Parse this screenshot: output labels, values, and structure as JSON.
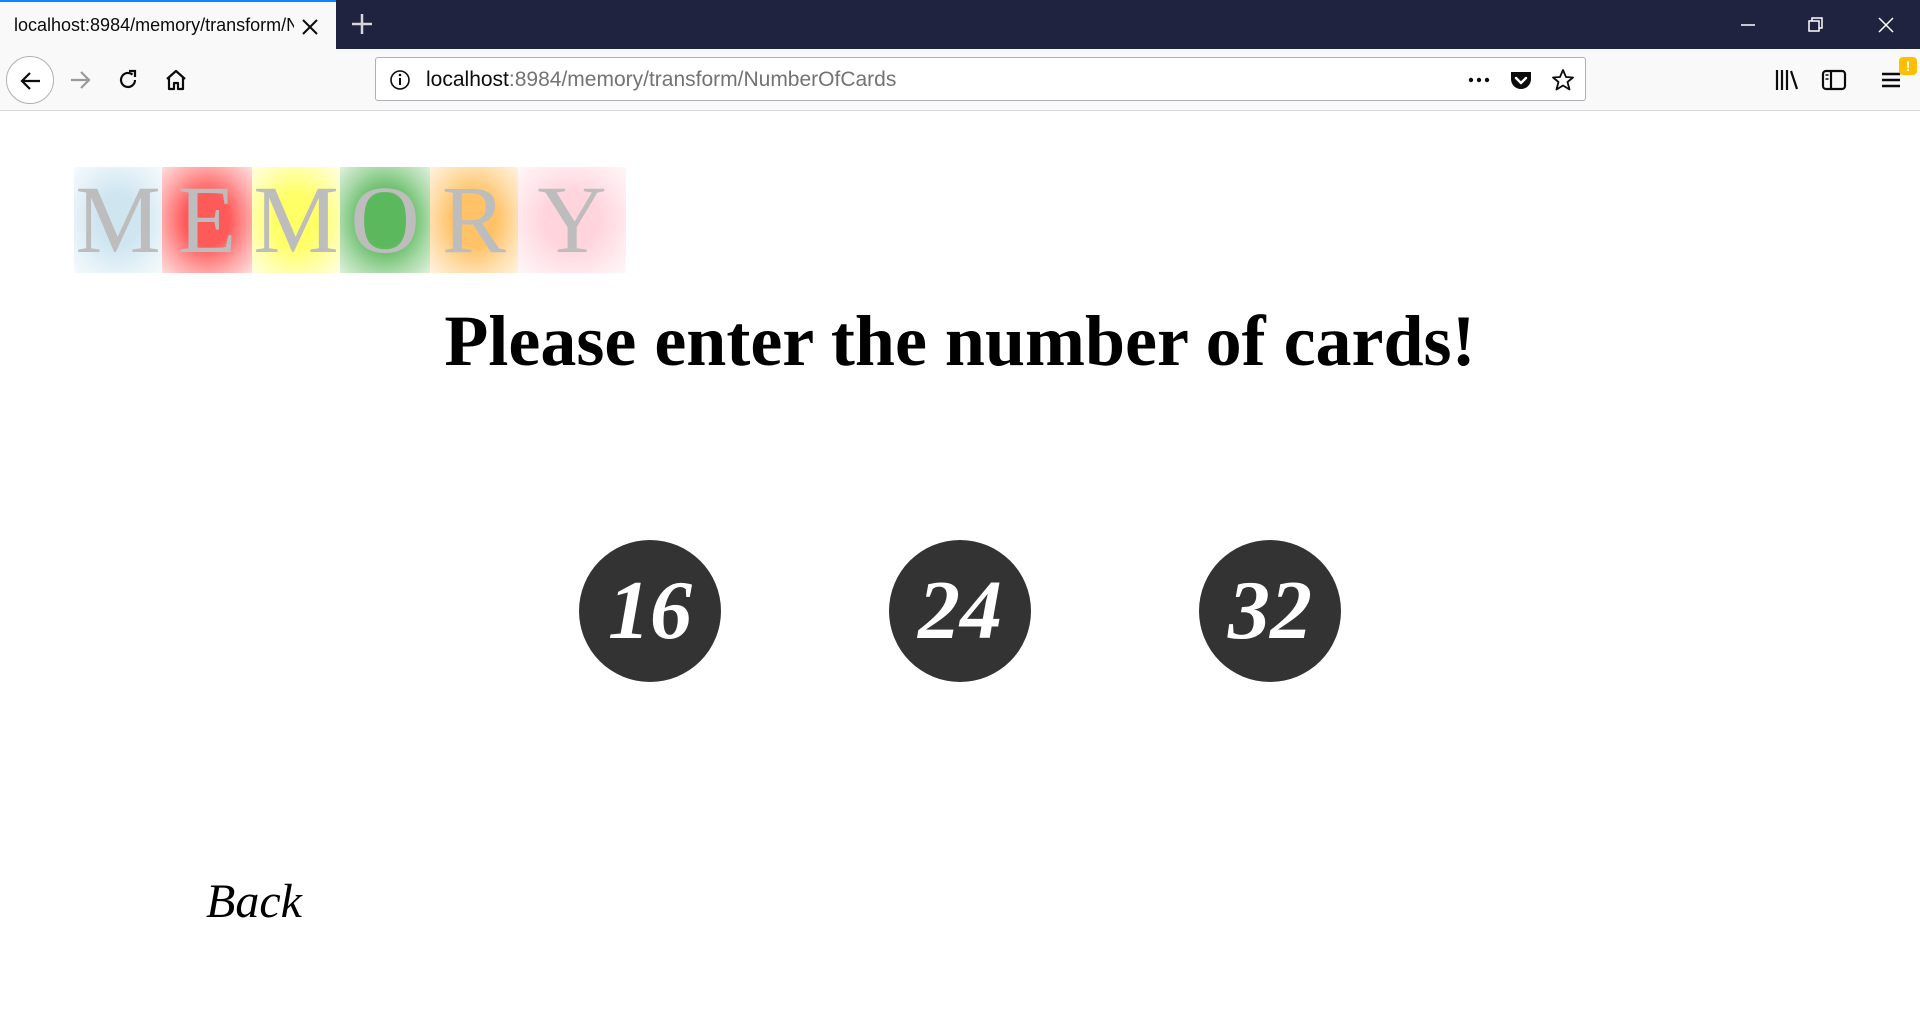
{
  "browser": {
    "tab_title": "localhost:8984/memory/transform/NumberOfCards",
    "url_host": "localhost",
    "url_path": ":8984/memory/transform/NumberOfCards",
    "accent_color": "#0a84ff",
    "titlebar_color": "#202340",
    "notification_badge": "!"
  },
  "page": {
    "logo": {
      "letters": [
        "M",
        "E",
        "M",
        "O",
        "R",
        "Y"
      ],
      "tile_colors": [
        "#cfe6f1",
        "#ff5a5a",
        "#ffff66",
        "#5cb85c",
        "#ffc266",
        "#ffd4dc"
      ]
    },
    "heading": "Please enter the number of cards!",
    "choices": [
      "16",
      "24",
      "32"
    ],
    "choice_color": "#333333",
    "back_label": "Back"
  }
}
